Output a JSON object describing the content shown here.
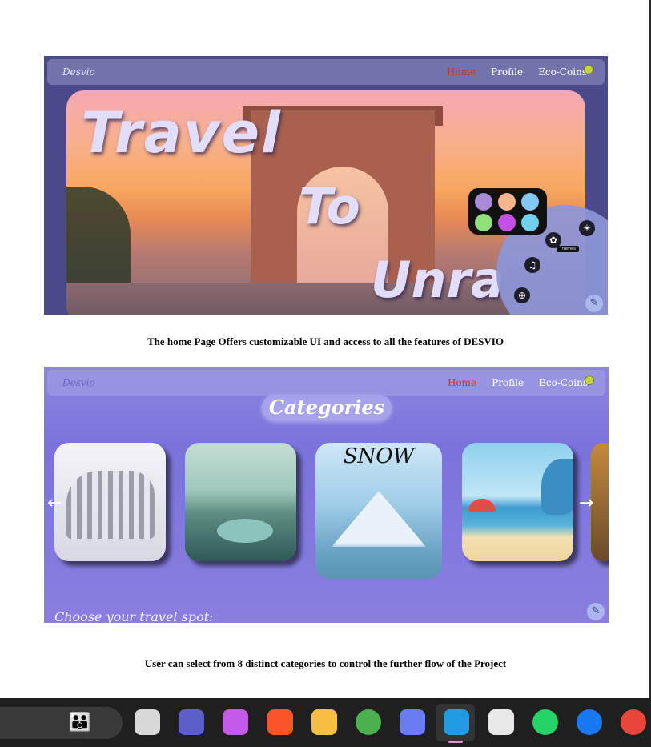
{
  "screenshot_home": {
    "nav": {
      "brand": "Desvio",
      "links": [
        "Home",
        "Profile",
        "Eco-Coins"
      ]
    },
    "hero_words": [
      "Travel",
      "To",
      "Unra"
    ],
    "palette_colors": [
      "#a98bd7",
      "#f6b58c",
      "#84c7f2",
      "#8fe07a",
      "#c64fe6",
      "#6fd0f0"
    ],
    "tooltip": "Themes",
    "icons": [
      "palette-icon",
      "sun-icon",
      "headset-icon",
      "zoom-icon",
      "pencil-icon"
    ]
  },
  "caption_1": "The home Page Offers customizable UI and access to all the features of DESVIO",
  "screenshot_categories": {
    "nav": {
      "brand": "Desvio",
      "links": [
        "Home",
        "Profile",
        "Eco-Coins"
      ]
    },
    "title": "Categories",
    "cards": [
      {
        "label": ""
      },
      {
        "label": ""
      },
      {
        "label": "SNOW"
      },
      {
        "label": ""
      },
      {
        "label": ""
      }
    ],
    "footer_text": "Choose your travel spot:",
    "prev_arrow": "←",
    "next_arrow": "→"
  },
  "caption_2": "User can select from 8 distinct categories  to control the further flow of the Project",
  "taskbar": {
    "apps": [
      {
        "name": "task-view-icon",
        "color": "#d8d8d8"
      },
      {
        "name": "teams-icon",
        "color": "#5b5fc7"
      },
      {
        "name": "copilot-icon",
        "color": "#c35be6"
      },
      {
        "name": "brave-icon",
        "color": "#fb542b"
      },
      {
        "name": "file-explorer-icon",
        "color": "#f5c042"
      },
      {
        "name": "chrome-icon",
        "color": "#4caf50"
      },
      {
        "name": "copilot-app-icon",
        "color": "#6a7cf0"
      },
      {
        "name": "edge-icon",
        "color": "#1f9be0"
      },
      {
        "name": "store-icon",
        "color": "#e8e8e8"
      },
      {
        "name": "whatsapp-icon",
        "color": "#25d366"
      },
      {
        "name": "facebook-icon",
        "color": "#1877f2"
      },
      {
        "name": "chrome-profile-icon",
        "color": "#e9453a"
      }
    ]
  }
}
